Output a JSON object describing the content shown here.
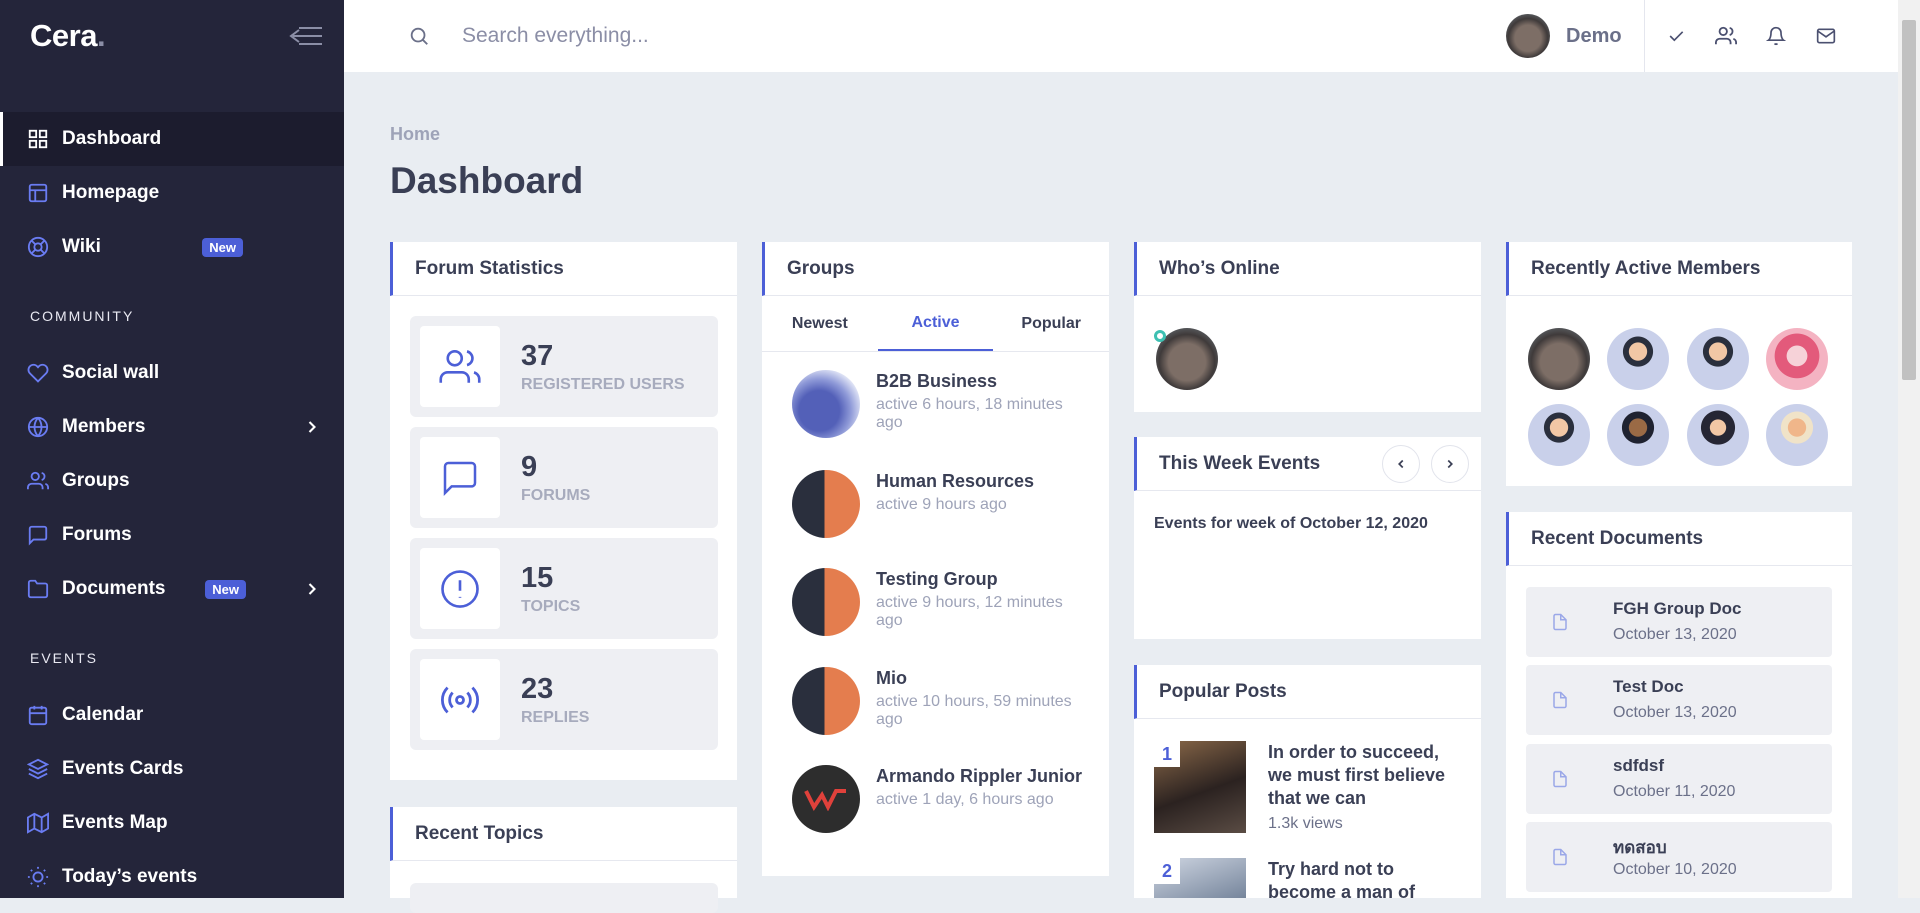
{
  "brand": {
    "name": "Cera",
    "dot": "."
  },
  "sidebar": {
    "items": [
      {
        "label": "Dashboard",
        "icon": "grid-icon"
      },
      {
        "label": "Homepage",
        "icon": "layout-icon"
      },
      {
        "label": "Wiki",
        "icon": "lifebuoy-icon",
        "badge": "New"
      }
    ],
    "community_title": "COMMUNITY",
    "community": [
      {
        "label": "Social wall",
        "icon": "heart-icon"
      },
      {
        "label": "Members",
        "icon": "globe-icon"
      },
      {
        "label": "Groups",
        "icon": "users-icon"
      },
      {
        "label": "Forums",
        "icon": "message-square-icon"
      },
      {
        "label": "Documents",
        "icon": "folder-icon",
        "badge": "New"
      }
    ],
    "events_title": "EVENTS",
    "events": [
      {
        "label": "Calendar",
        "icon": "calendar-icon"
      },
      {
        "label": "Events Cards",
        "icon": "layers-icon"
      },
      {
        "label": "Events Map",
        "icon": "map-icon"
      },
      {
        "label": "Today’s events",
        "icon": "sun-icon"
      }
    ]
  },
  "search": {
    "placeholder": "Search everything..."
  },
  "user": {
    "name": "Demo"
  },
  "page": {
    "breadcrumb": "Home",
    "title": "Dashboard"
  },
  "forum_stats": {
    "title": "Forum Statistics",
    "items": [
      {
        "value": "37",
        "label": "REGISTERED USERS"
      },
      {
        "value": "9",
        "label": "FORUMS"
      },
      {
        "value": "15",
        "label": "TOPICS"
      },
      {
        "value": "23",
        "label": "REPLIES"
      }
    ]
  },
  "recent_topics": {
    "title": "Recent Topics"
  },
  "groups": {
    "title": "Groups",
    "tabs": [
      "Newest",
      "Active",
      "Popular"
    ],
    "items": [
      {
        "name": "B2B Business",
        "meta": "active 6 hours, 18 minutes ago"
      },
      {
        "name": "Human Resources",
        "meta": "active 9 hours ago"
      },
      {
        "name": "Testing Group",
        "meta": "active 9 hours, 12 minutes ago"
      },
      {
        "name": "Mio",
        "meta": "active 10 hours, 59 minutes ago"
      },
      {
        "name": "Armando Rippler Junior",
        "meta": "active 1 day, 6 hours ago"
      }
    ]
  },
  "whos_online": {
    "title": "Who’s Online"
  },
  "week_events": {
    "title": "This Week Events",
    "text": "Events for week of October 12, 2020"
  },
  "popular_posts": {
    "title": "Popular Posts",
    "items": [
      {
        "num": "1",
        "title": "In order to succeed, we must first believe that we can",
        "views": "1.3k views"
      },
      {
        "num": "2",
        "title": "Try hard not to become a man of"
      }
    ]
  },
  "members": {
    "title": "Recently Active Members"
  },
  "documents": {
    "title": "Recent Documents",
    "items": [
      {
        "name": "FGH Group Doc",
        "date": "October 13, 2020"
      },
      {
        "name": "Test Doc",
        "date": "October 13, 2020"
      },
      {
        "name": "sdfdsf",
        "date": "October 11, 2020"
      },
      {
        "name": "ทดสอบ",
        "date": "October 10, 2020"
      }
    ]
  },
  "colors": {
    "sidebar": "#24253a",
    "accent": "#4c5fd7",
    "background": "#e9edf2"
  }
}
